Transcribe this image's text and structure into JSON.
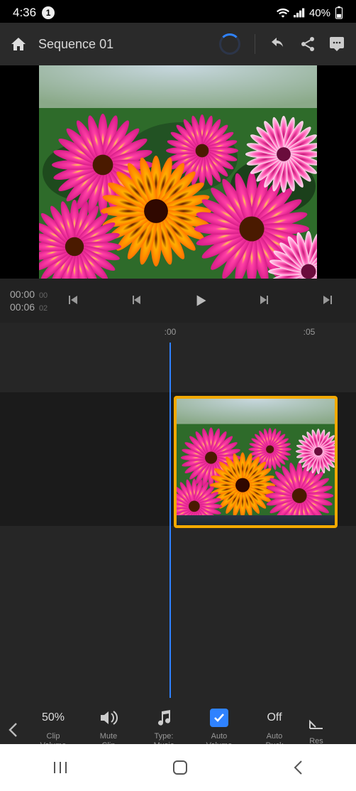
{
  "status": {
    "time": "4:36",
    "notifications": "1",
    "battery": "40%"
  },
  "toolbar": {
    "title": "Sequence 01"
  },
  "playback": {
    "cur": "00:00",
    "cur_frame": "00",
    "dur": "00:06",
    "dur_frame": "02"
  },
  "ruler": {
    "t0": ":00",
    "t5": ":05"
  },
  "options": {
    "clip_volume": {
      "value": "50%",
      "label": "Clip\nVolume"
    },
    "mute_clip": {
      "label": "Mute\nClip"
    },
    "type": {
      "label": "Type:\nMusic"
    },
    "auto_volume": {
      "label": "Auto\nVolume"
    },
    "auto_duck": {
      "value": "Off",
      "label": "Auto\nDuck"
    },
    "reset": {
      "label": "Res"
    }
  }
}
